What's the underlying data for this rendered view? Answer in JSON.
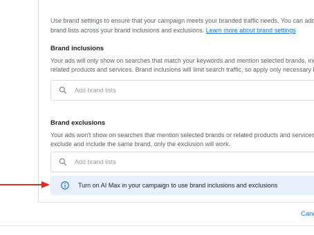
{
  "brand_settings": {
    "intro_line1": "Use brand settings to ensure that your campaign meets your branded traffic needs. You can add up",
    "intro_line2_prefix": "brand lists across your brand inclusions and exclusions. ",
    "learn_more_link": "Learn more about brand settings"
  },
  "inclusions": {
    "title": "Brand inclusions",
    "desc_line1": "Your ads will only show on searches that match your keywords and mention selected brands, inclu",
    "desc_line2": "related products and services. Brand inclusions will limit search traffic, so apply only necessary bra",
    "search_placeholder": "Add brand lists"
  },
  "exclusions": {
    "title": "Brand exclusions",
    "desc_line1": "Your ads won't show on searches that mention selected brands or related products and services. If",
    "desc_line2": "exclude and include the same brand, only the exclusion will work.",
    "search_placeholder": "Add brand lists"
  },
  "info_banner": {
    "text": "Turn on AI Max in your campaign to use brand inclusions and exclusions",
    "icon": "info-icon"
  },
  "footer": {
    "cancel_label": "Canc"
  },
  "colors": {
    "accent": "#1a73e8",
    "banner_bg": "#e8f0fe",
    "arrow": "#d93025"
  }
}
